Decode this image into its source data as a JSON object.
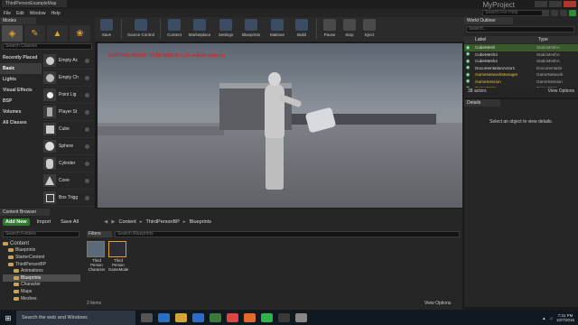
{
  "window": {
    "doc_tab": "ThirdPersonExampleMap",
    "project": "MyProject",
    "search_help_placeholder": "Search For Help"
  },
  "menu": [
    "File",
    "Edit",
    "Window",
    "Help"
  ],
  "modes": {
    "tab": "Modes",
    "search_placeholder": "Search Classes",
    "categories": [
      "Recently Placed",
      "Basic",
      "Lights",
      "Visual Effects",
      "BSP",
      "Volumes",
      "All Classes"
    ],
    "active_category": "Basic",
    "items": [
      "Empty Ac",
      "Empty Ch",
      "Point Lig",
      "Player St",
      "Cube",
      "Sphere",
      "Cylinder",
      "Cone",
      "Box Trigg"
    ]
  },
  "toolbar": [
    {
      "label": "Save",
      "icon": "save-icon"
    },
    {
      "label": "Source Control",
      "icon": "source-control-icon"
    },
    {
      "label": "Content",
      "icon": "content-icon"
    },
    {
      "label": "Marketplace",
      "icon": "marketplace-icon"
    },
    {
      "label": "Settings",
      "icon": "settings-icon"
    },
    {
      "label": "Blueprints",
      "icon": "blueprints-icon"
    },
    {
      "label": "Matinee",
      "icon": "matinee-icon"
    },
    {
      "label": "Build",
      "icon": "build-icon"
    },
    {
      "label": "Pause",
      "icon": "pause-icon"
    },
    {
      "label": "Stop",
      "icon": "stop-icon"
    },
    {
      "label": "Eject",
      "icon": "eject-icon"
    }
  ],
  "viewport": {
    "message": "LIGHTING NEEDS TO BE REBUILT (10 unbuilt objects)"
  },
  "outliner": {
    "tab": "World Outliner",
    "search_placeholder": "Search...",
    "col_label": "Label",
    "col_type": "Type",
    "rows": [
      {
        "name": "CubeMesh",
        "type": "StaticMeshA"
      },
      {
        "name": "CubeMesh3",
        "type": "StaticMeshA"
      },
      {
        "name": "CubeMesh4",
        "type": "StaticMeshA"
      },
      {
        "name": "DocumentationActor1",
        "type": "Documentatio"
      },
      {
        "name": "GameNetworkManager",
        "type": "GameNetwork"
      },
      {
        "name": "GameSession",
        "type": "GameSession"
      },
      {
        "name": "GameState",
        "type": "GameState"
      }
    ],
    "count": "38 actors",
    "view_options": "View Options"
  },
  "details": {
    "tab": "Details",
    "message": "Select an object to view details."
  },
  "content_browser": {
    "tab": "Content Browser",
    "add_new": "Add New",
    "import": "Import",
    "save_all": "Save All",
    "path": [
      "Content",
      "ThirdPersonBP",
      "Blueprints"
    ],
    "search_folders": "Search Folders",
    "filters": "Filters",
    "search_assets": "Search Blueprints",
    "tree": [
      {
        "label": "Content",
        "level": 0
      },
      {
        "label": "Blueprints",
        "level": 1
      },
      {
        "label": "StarterContent",
        "level": 1
      },
      {
        "label": "ThirdPersonBP",
        "level": 1
      },
      {
        "label": "Animations",
        "level": 2
      },
      {
        "label": "Blueprints",
        "level": 2,
        "selected": true
      },
      {
        "label": "Character",
        "level": 2
      },
      {
        "label": "Maps",
        "level": 2
      },
      {
        "label": "Meshes",
        "level": 2
      }
    ],
    "assets": [
      {
        "label": "Third Person Character"
      },
      {
        "label": "Third Person GameMode"
      }
    ],
    "count": "2 items",
    "view_options": "View Options"
  },
  "taskbar": {
    "search": "Search the web and Windows",
    "time": "7:31 PM",
    "date": "10/7/2016"
  }
}
